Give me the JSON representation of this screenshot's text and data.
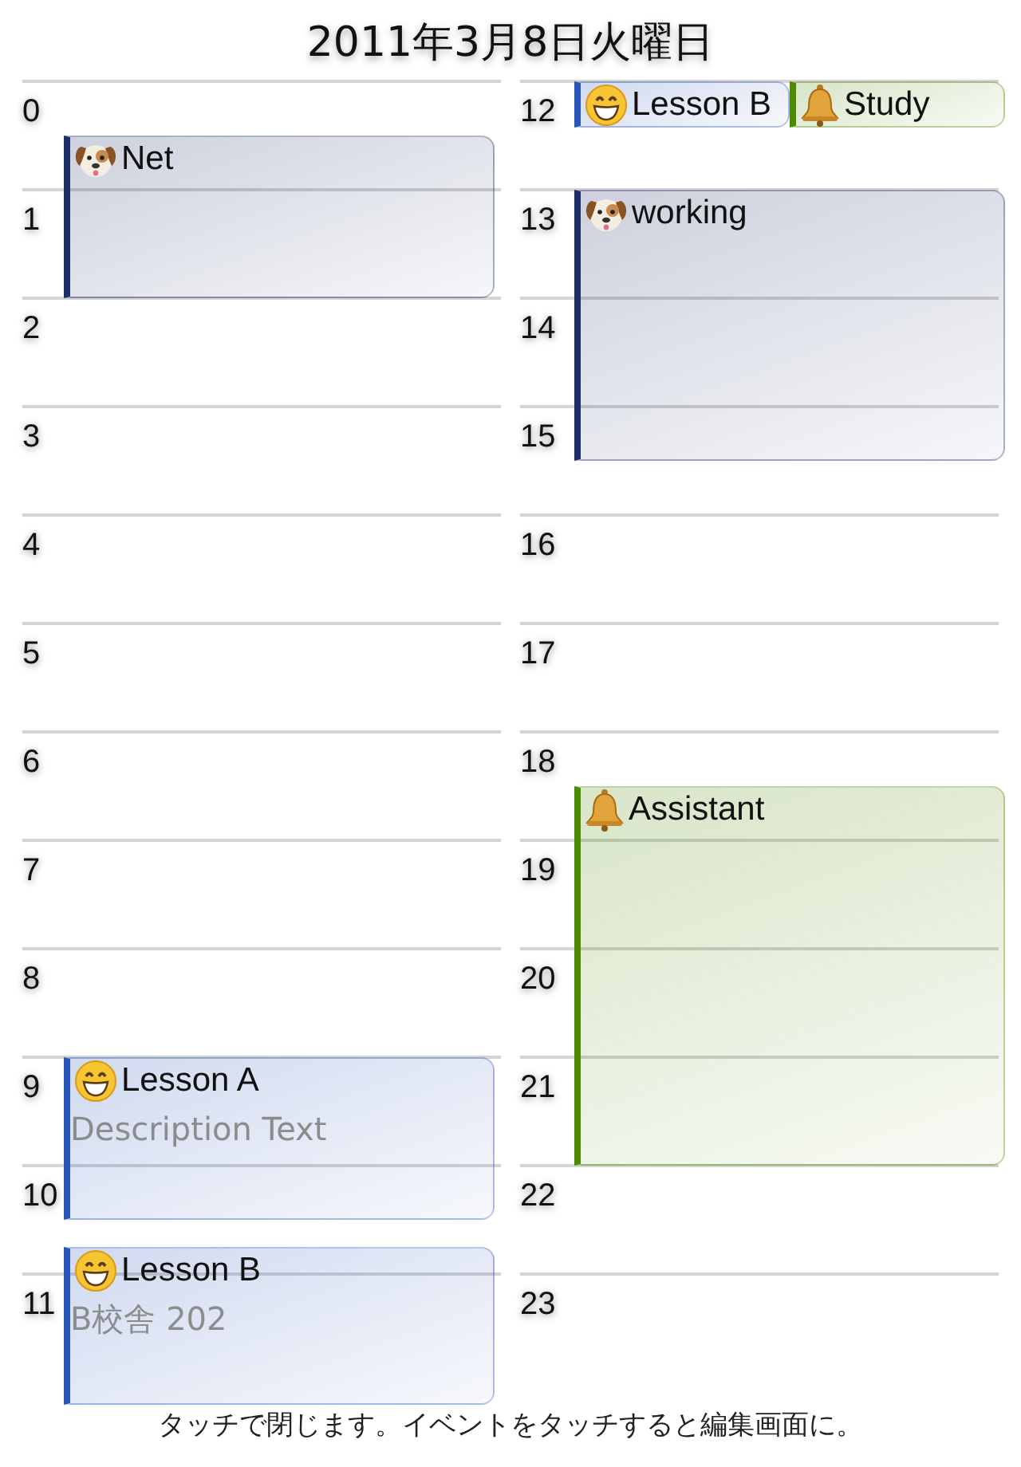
{
  "title": "2011年3月8日火曜日",
  "columns": [
    {
      "hours": [
        "0",
        "1",
        "2",
        "3",
        "4",
        "5",
        "6",
        "7",
        "8",
        "9",
        "10",
        "11"
      ],
      "events": [
        {
          "title": "Net",
          "kind": "dog",
          "color": "#1c2f66"
        },
        {
          "title": "Lesson A",
          "description": "Description Text",
          "kind": "grin",
          "color": "#2a55b8"
        },
        {
          "title": "Lesson B",
          "description": "B校舎 202",
          "kind": "grin",
          "color": "#2a55b8"
        }
      ]
    },
    {
      "hours": [
        "12",
        "13",
        "14",
        "15",
        "16",
        "17",
        "18",
        "19",
        "20",
        "21",
        "22",
        "23"
      ],
      "events": [
        {
          "title": "Lesson B",
          "kind": "grin",
          "color": "#2a55b8"
        },
        {
          "title": "Study",
          "kind": "bell",
          "color": "#4d8a00"
        },
        {
          "title": "working",
          "kind": "dog",
          "color": "#1c2f66"
        },
        {
          "title": "Assistant",
          "kind": "bell",
          "color": "#4d8a00"
        }
      ]
    }
  ],
  "footer": "タッチで閉じます。イベントをタッチすると編集画面に。"
}
